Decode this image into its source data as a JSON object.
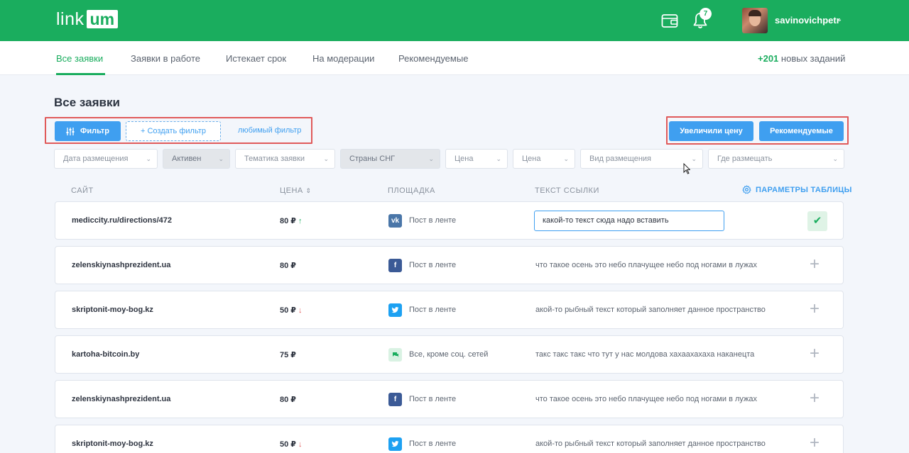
{
  "header": {
    "logo_left": "link",
    "logo_right": "um",
    "notifications_count": "7",
    "username": "savinovichpetr",
    "user_caret": "⌄",
    "colors": {
      "brand": "#1aad5e",
      "accent": "#3f9ff0",
      "highlight": "#e05a5a"
    }
  },
  "tabs": [
    {
      "label": "Все заявки",
      "active": true
    },
    {
      "label": "Заявки в работе"
    },
    {
      "label": "Истекает срок"
    },
    {
      "label": "На модерации"
    },
    {
      "label": "Рекомендуемые"
    }
  ],
  "new_tasks": {
    "count": "+201",
    "label": " новых заданий"
  },
  "page_title": "Все заявки",
  "toolbar": {
    "filter_btn": "Фильтр",
    "create_filter_btn": "+  Создать фильтр",
    "favorite_filter": "любимый фильтр",
    "price_increased_btn": "Увеличили цену",
    "recommended_btn": "Рекомендуемые"
  },
  "filters": [
    "Дата размещения",
    "Активен",
    "Тематика заявки",
    "Страны СНГ",
    "Цена",
    "Цена",
    "Вид размещения",
    "Где размещать"
  ],
  "table": {
    "headers": {
      "site": "САЙТ",
      "price": "ЦЕНА",
      "price_sort": "⇕",
      "platform": "ПЛОЩАДКА",
      "link_text": "ТЕКСТ ССЫЛКИ",
      "settings": "ПАРАМЕТРЫ ТАБЛИЦЫ"
    },
    "rows": [
      {
        "site": "mediccity.ru/directions/472",
        "price": "80 ₽",
        "trend": "↑",
        "platform_icon": "vk-icon",
        "platform": "Пост в ленте",
        "link_text": "какой-то текст сюда надо вставить",
        "editing": true
      },
      {
        "site": "zelenskiynashprezident.ua",
        "price": "80 ₽",
        "trend": "",
        "platform_icon": "facebook-icon",
        "platform": "Пост в ленте",
        "link_text": "что такое осень это небо плачущее небо под ногами в лужах"
      },
      {
        "site": "skriptonit-moy-bog.kz",
        "price": "50 ₽",
        "trend": "↓",
        "platform_icon": "twitter-icon",
        "platform": "Пост в ленте",
        "link_text": "акой-то рыбный текст который заполняет данное пространство"
      },
      {
        "site": "kartoha-bitcoin.by",
        "price": "75 ₽",
        "trend": "",
        "platform_icon": "chat-icon",
        "platform": "Все, кроме соц. сетей",
        "link_text": "такс такс такс что тут у нас молдова хахаахахаха наканецта"
      },
      {
        "site": "zelenskiynashprezident.ua",
        "price": "80 ₽",
        "trend": "",
        "platform_icon": "facebook-icon",
        "platform": "Пост в ленте",
        "link_text": "что такое осень это небо плачущее небо под ногами в лужах"
      },
      {
        "site": "skriptonit-moy-bog.kz",
        "price": "50 ₽",
        "trend": "↓",
        "platform_icon": "twitter-icon",
        "platform": "Пост в ленте",
        "link_text": "акой-то рыбный текст который заполняет данное пространство"
      }
    ]
  }
}
